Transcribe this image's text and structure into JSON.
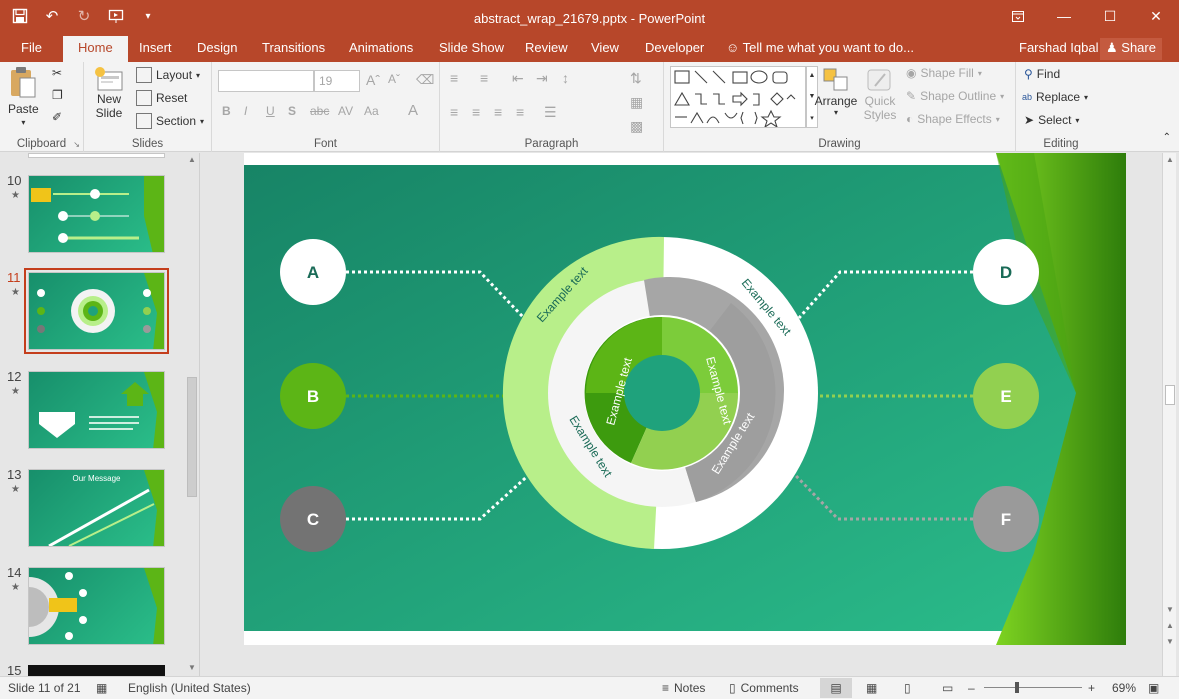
{
  "window": {
    "title": "abstract_wrap_21679.pptx - PowerPoint",
    "user": "Farshad Iqbal",
    "share_label": "Share"
  },
  "tabs": [
    {
      "label": "File"
    },
    {
      "label": "Home"
    },
    {
      "label": "Insert"
    },
    {
      "label": "Design"
    },
    {
      "label": "Transitions"
    },
    {
      "label": "Animations"
    },
    {
      "label": "Slide Show"
    },
    {
      "label": "Review"
    },
    {
      "label": "View"
    },
    {
      "label": "Developer"
    }
  ],
  "tell_me": "Tell me what you want to do...",
  "ribbon": {
    "clipboard": {
      "paste": "Paste",
      "label": "Clipboard"
    },
    "slides": {
      "new_slide_1": "New",
      "new_slide_2": "Slide",
      "layout": "Layout",
      "reset": "Reset",
      "section": "Section",
      "label": "Slides"
    },
    "font": {
      "font_size": "19",
      "label": "Font"
    },
    "paragraph": {
      "label": "Paragraph"
    },
    "drawing": {
      "arrange": "Arrange",
      "quick_styles_1": "Quick",
      "quick_styles_2": "Styles",
      "shape_fill": "Shape Fill",
      "shape_outline": "Shape Outline",
      "shape_effects": "Shape Effects",
      "label": "Drawing"
    },
    "editing": {
      "find": "Find",
      "replace": "Replace",
      "select": "Select",
      "label": "Editing"
    }
  },
  "thumbnails": [
    {
      "num": "10",
      "title": ""
    },
    {
      "num": "11",
      "title": ""
    },
    {
      "num": "12",
      "title": ""
    },
    {
      "num": "13",
      "title": "Our Message"
    },
    {
      "num": "14",
      "title": ""
    },
    {
      "num": "15",
      "title": ""
    }
  ],
  "slide": {
    "circles": [
      {
        "letter": "A",
        "color": "#ffffff",
        "text_color": "#1a6b57"
      },
      {
        "letter": "B",
        "color": "#5cb516",
        "text_color": "#ffffff"
      },
      {
        "letter": "C",
        "color": "#737373",
        "text_color": "#ffffff"
      },
      {
        "letter": "D",
        "color": "#ffffff",
        "text_color": "#1a6b57"
      },
      {
        "letter": "E",
        "color": "#92d050",
        "text_color": "#ffffff"
      },
      {
        "letter": "F",
        "color": "#9a9a9a",
        "text_color": "#ffffff"
      }
    ],
    "example_text": "Example text",
    "colors": {
      "bg_dark": "#178466",
      "bg_light": "#2bbd8b",
      "green_dark": "#3d9b0e",
      "green_light": "#b8ef8a",
      "gray": "#a6a6a6"
    }
  },
  "status": {
    "slide_info": "Slide 11 of 21",
    "language": "English (United States)",
    "notes": "Notes",
    "comments": "Comments",
    "zoom": "69%"
  }
}
